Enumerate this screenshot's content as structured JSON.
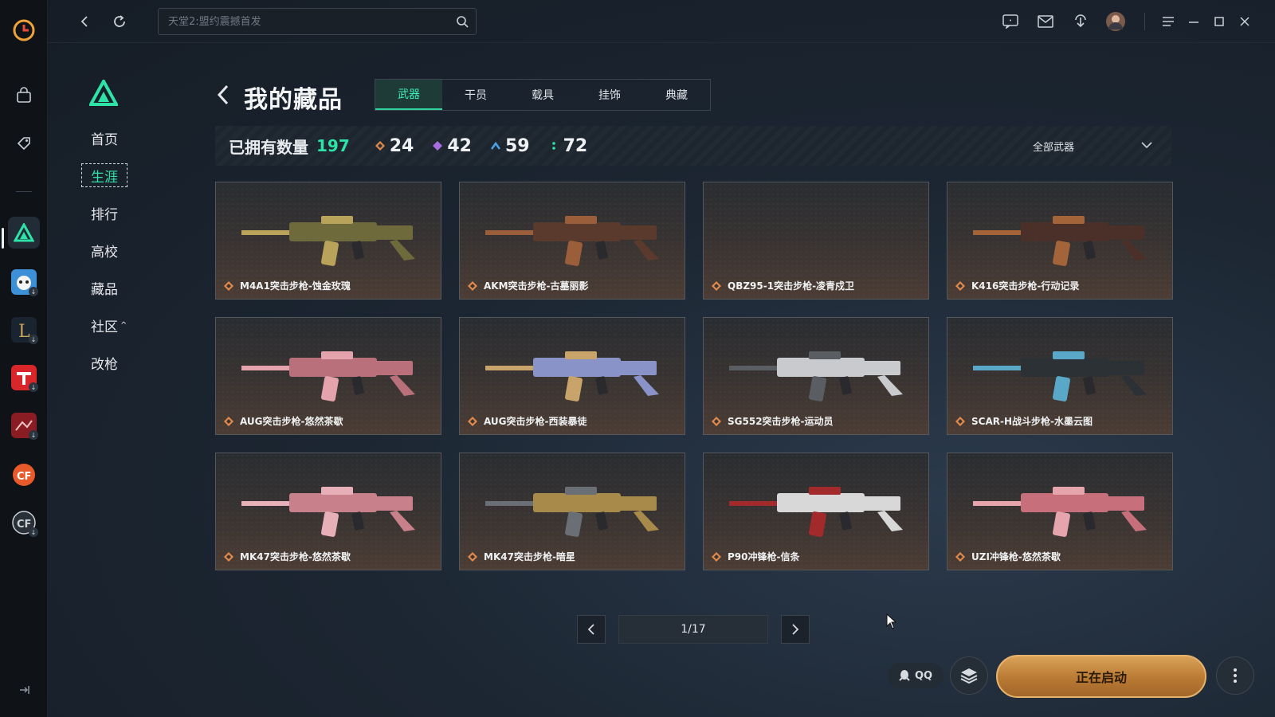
{
  "search": {
    "placeholder": "天堂2:盟约震撼首发"
  },
  "nav": {
    "items": [
      {
        "label": "首页"
      },
      {
        "label": "生涯"
      },
      {
        "label": "排行"
      },
      {
        "label": "高校"
      },
      {
        "label": "藏品"
      },
      {
        "label": "社区"
      },
      {
        "label": "改枪"
      }
    ],
    "active": "生涯"
  },
  "header": {
    "title": "我的藏品",
    "tabs": [
      {
        "label": "武器"
      },
      {
        "label": "干员"
      },
      {
        "label": "载具"
      },
      {
        "label": "挂饰"
      },
      {
        "label": "典藏"
      }
    ]
  },
  "stats": {
    "owned_label": "已拥有数量",
    "owned_count": "197",
    "rarities": [
      {
        "value": "24",
        "color": "#e38a4a",
        "icon": "orange-diamond-icon"
      },
      {
        "value": "42",
        "color": "#a86de0",
        "icon": "purple-diamond-icon"
      },
      {
        "value": "59",
        "color": "#4aa3e8",
        "icon": "blue-chevron-icon"
      },
      {
        "value": "72",
        "color": "#2ee3a7",
        "icon": "green-dots-icon"
      }
    ],
    "filter_label": "全部武器"
  },
  "items": [
    {
      "name": "M4A1突击步枪-蚀金玫瑰",
      "rarity_color": "#e38a4a",
      "body": "#6f6a3c",
      "accent": "#b9a25a"
    },
    {
      "name": "AKM突击步枪-古墓丽影",
      "rarity_color": "#e38a4a",
      "body": "#5a3a2c",
      "accent": "#9a5f3a"
    },
    {
      "name": "QBZ95-1突击步枪-凌青戍卫",
      "rarity_color": "#e38a4a",
      "body": "",
      "accent": ""
    },
    {
      "name": "K416突击步枪-行动记录",
      "rarity_color": "#e38a4a",
      "body": "#4a3028",
      "accent": "#a3643a"
    },
    {
      "name": "AUG突击步枪-悠然茶歇",
      "rarity_color": "#e38a4a",
      "body": "#b9707a",
      "accent": "#e4a3ad"
    },
    {
      "name": "AUG突击步枪-西装暴徒",
      "rarity_color": "#e38a4a",
      "body": "#8a93c8",
      "accent": "#c9a46a"
    },
    {
      "name": "SG552突击步枪-运动员",
      "rarity_color": "#e38a4a",
      "body": "#c8cacd",
      "accent": "#5a5d62"
    },
    {
      "name": "SCAR-H战斗步枪-水墨云图",
      "rarity_color": "#e38a4a",
      "body": "#2c3136",
      "accent": "#5aa8c8"
    },
    {
      "name": "MK47突击步枪-悠然茶歇",
      "rarity_color": "#e38a4a",
      "body": "#c8808a",
      "accent": "#e7b0b8"
    },
    {
      "name": "MK47突击步枪-暗星",
      "rarity_color": "#e38a4a",
      "body": "#a88a4a",
      "accent": "#6a6f75"
    },
    {
      "name": "P90冲锋枪-信条",
      "rarity_color": "#e38a4a",
      "body": "#d8d8d8",
      "accent": "#a32a2a"
    },
    {
      "name": "UZI冲锋枪-悠然茶歇",
      "rarity_color": "#e38a4a",
      "body": "#c7707c",
      "accent": "#e6a4ad"
    }
  ],
  "pagination": {
    "label": "1/17"
  },
  "launcher": {
    "qq_label": "QQ",
    "launch_label": "正在启动"
  }
}
